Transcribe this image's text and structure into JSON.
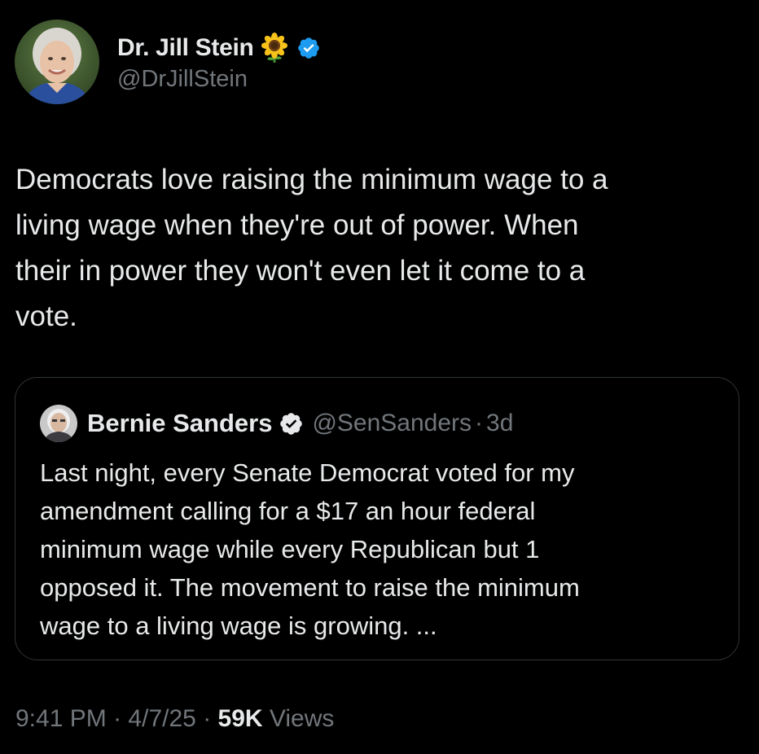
{
  "author": {
    "display_name": "Dr. Jill Stein",
    "handle": "@DrJillStein",
    "badge_emoji": "sunflower",
    "verified": true
  },
  "tweet": {
    "text": "Democrats love raising the minimum wage to a\nliving wage when they're out of power. When\ntheir in power they won't even let it come to a\nvote."
  },
  "quoted_tweet": {
    "display_name": "Bernie Sanders",
    "handle": "@SenSanders",
    "separator": "·",
    "time": "3d",
    "verified": true,
    "text": "Last night, every Senate Democrat voted for my\namendment calling for a $17 an hour federal\nminimum wage while every Republican but 1\nopposed it. The movement to raise the minimum\nwage to a living wage is growing. ..."
  },
  "meta": {
    "time": "9:41 PM",
    "separator": "·",
    "date": "4/7/25",
    "views_count": "59K",
    "views_label": "Views"
  },
  "colors": {
    "background": "#000000",
    "primary_text": "#e7e9ea",
    "secondary_text": "#71767b",
    "verified_blue": "#1d9bf0",
    "card_border": "#2f3336"
  }
}
